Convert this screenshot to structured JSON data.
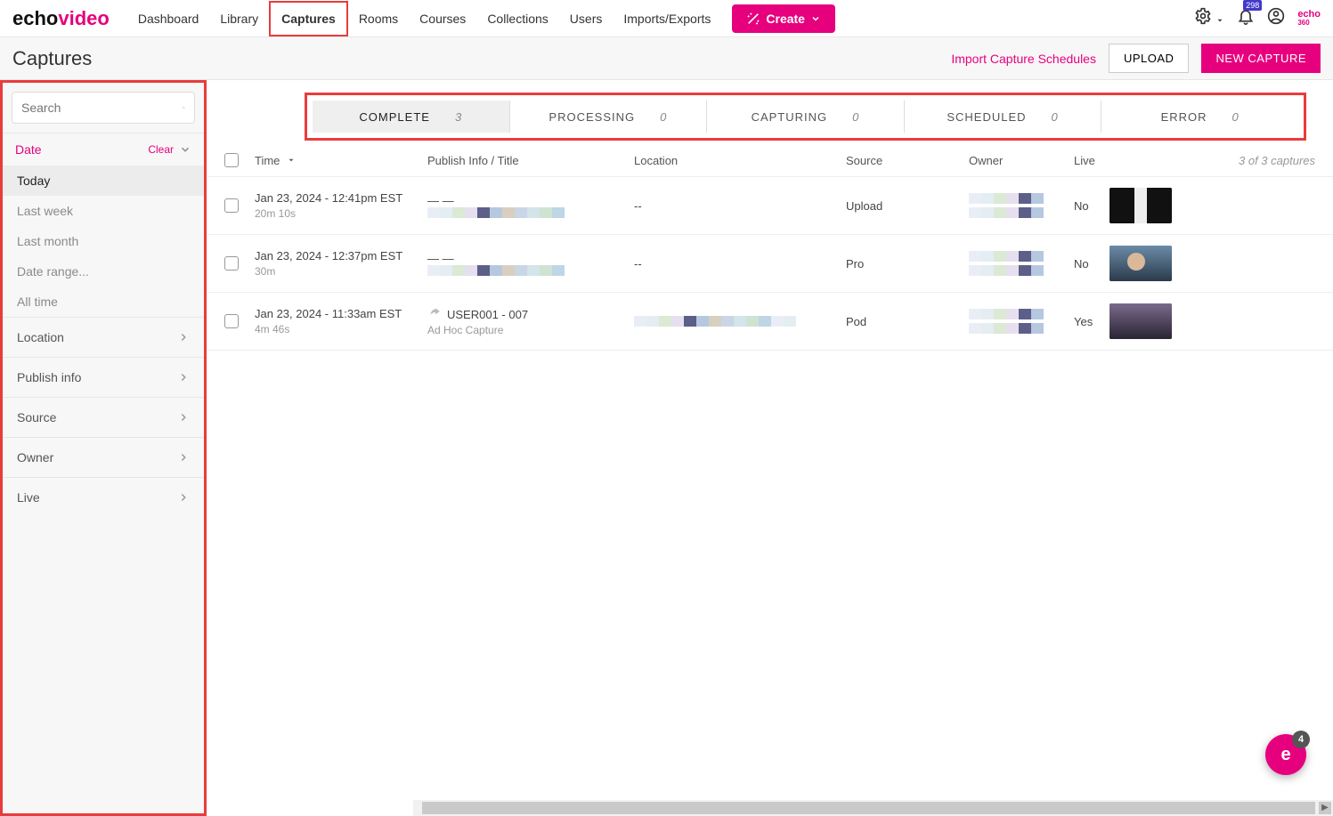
{
  "brand": {
    "part1": "echo",
    "part2": "video",
    "sm1": "echo",
    "sm2": "360"
  },
  "nav": {
    "items": [
      "Dashboard",
      "Library",
      "Captures",
      "Rooms",
      "Courses",
      "Collections",
      "Users",
      "Imports/Exports"
    ],
    "activeIndex": 2,
    "createLabel": "Create",
    "notifBadge": "298"
  },
  "page": {
    "title": "Captures",
    "importLink": "Import Capture Schedules",
    "uploadBtn": "UPLOAD",
    "newBtn": "NEW CAPTURE"
  },
  "search": {
    "placeholder": "Search"
  },
  "filters": {
    "dateLabel": "Date",
    "clearLabel": "Clear",
    "dateOptions": [
      "Today",
      "Last week",
      "Last month",
      "Date range...",
      "All time"
    ],
    "dateSelected": 0,
    "facets": [
      "Location",
      "Publish info",
      "Source",
      "Owner",
      "Live"
    ]
  },
  "statusTabs": [
    {
      "label": "COMPLETE",
      "count": "3",
      "active": true
    },
    {
      "label": "PROCESSING",
      "count": "0",
      "active": false
    },
    {
      "label": "CAPTURING",
      "count": "0",
      "active": false
    },
    {
      "label": "SCHEDULED",
      "count": "0",
      "active": false
    },
    {
      "label": "ERROR",
      "count": "0",
      "active": false
    }
  ],
  "columns": {
    "time": "Time",
    "publish": "Publish Info / Title",
    "location": "Location",
    "source": "Source",
    "owner": "Owner",
    "live": "Live"
  },
  "countLabel": "3 of 3 captures",
  "rows": [
    {
      "date": "Jan 23, 2024 - 12:41pm EST",
      "duration": "20m 10s",
      "publishTitle": "— —",
      "publishSub": "",
      "location": "--",
      "source": "Upload",
      "live": "No",
      "thumb": "bw",
      "blurPub": true,
      "blurOwner": true,
      "share": false
    },
    {
      "date": "Jan 23, 2024 - 12:37pm EST",
      "duration": "30m",
      "publishTitle": "— —",
      "publishSub": "",
      "location": "--",
      "source": "Pro",
      "live": "No",
      "thumb": "person",
      "blurPub": true,
      "blurOwner": true,
      "share": false
    },
    {
      "date": "Jan 23, 2024 - 11:33am EST",
      "duration": "4m 46s",
      "publishTitle": "USER001 - 007",
      "publishSub": "Ad Hoc Capture",
      "location": "",
      "source": "Pod",
      "live": "Yes",
      "thumb": "room",
      "blurPub": false,
      "blurLoc": true,
      "blurOwner": true,
      "share": true
    }
  ],
  "fabCount": "4",
  "blurColors": [
    "#e9eef6",
    "#e4edf2",
    "#dbe9d5",
    "#e6dfef",
    "#5c5f87",
    "#b6c8e0",
    "#d9cfc0",
    "#c9d6e6",
    "#d3e4ea",
    "#cfe3d2",
    "#bed6e6"
  ]
}
